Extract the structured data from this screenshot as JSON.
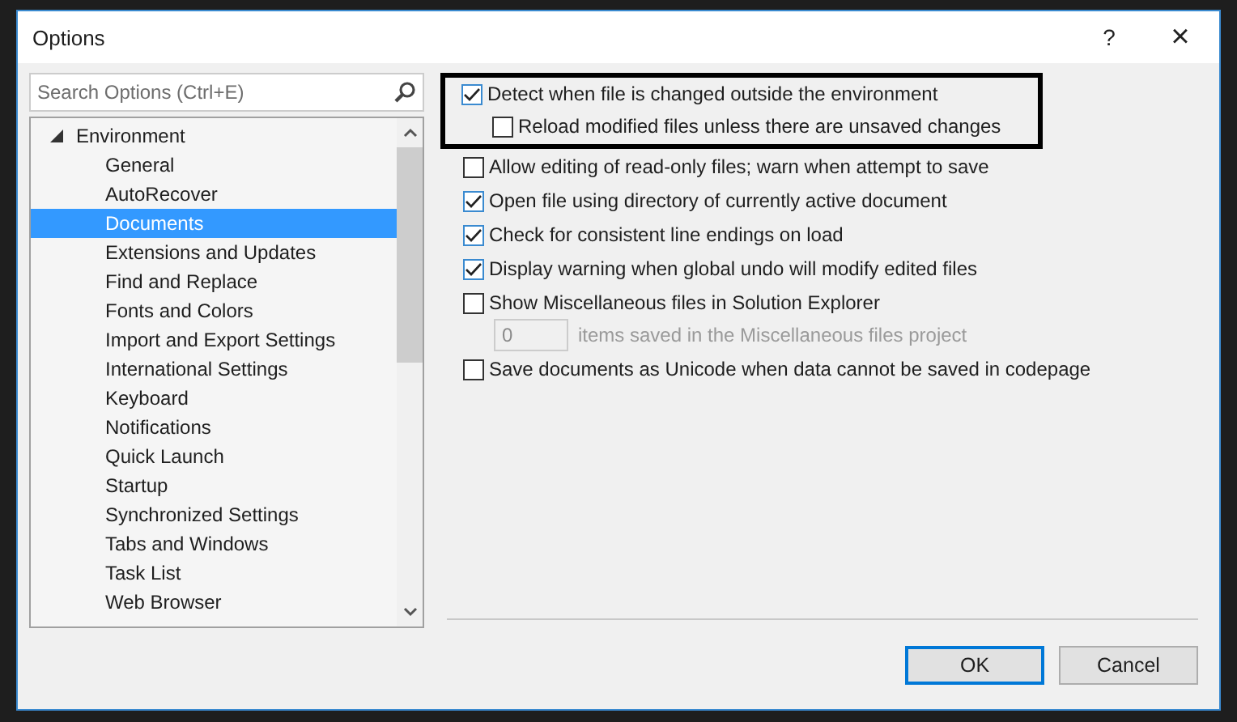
{
  "window": {
    "title": "Options",
    "help": "?",
    "close": "×"
  },
  "search": {
    "placeholder": "Search Options (Ctrl+E)"
  },
  "tree": [
    {
      "label": "Environment",
      "expanded": true,
      "selected": false,
      "children": [
        {
          "label": "General",
          "selected": false
        },
        {
          "label": "AutoRecover",
          "selected": false
        },
        {
          "label": "Documents",
          "selected": true
        },
        {
          "label": "Extensions and Updates",
          "selected": false
        },
        {
          "label": "Find and Replace",
          "selected": false
        },
        {
          "label": "Fonts and Colors",
          "selected": false
        },
        {
          "label": "Import and Export Settings",
          "selected": false
        },
        {
          "label": "International Settings",
          "selected": false
        },
        {
          "label": "Keyboard",
          "selected": false
        },
        {
          "label": "Notifications",
          "selected": false
        },
        {
          "label": "Quick Launch",
          "selected": false
        },
        {
          "label": "Startup",
          "selected": false
        },
        {
          "label": "Synchronized Settings",
          "selected": false
        },
        {
          "label": "Tabs and Windows",
          "selected": false
        },
        {
          "label": "Task List",
          "selected": false
        },
        {
          "label": "Web Browser",
          "selected": false
        }
      ]
    }
  ],
  "options": [
    {
      "kind": "checkbox",
      "label": "Detect when file is changed outside the environment",
      "checked": true,
      "highlighted": true,
      "children": [
        {
          "kind": "checkbox",
          "label": "Reload modified files unless there are unsaved changes",
          "checked": false
        }
      ]
    },
    {
      "kind": "checkbox",
      "label": "Allow editing of read-only files; warn when attempt to save",
      "checked": false,
      "highlighted": false
    },
    {
      "kind": "checkbox",
      "label": "Open file using directory of currently active document",
      "checked": true,
      "highlighted": false
    },
    {
      "kind": "checkbox",
      "label": "Check for consistent line endings on load",
      "checked": true,
      "highlighted": false
    },
    {
      "kind": "checkbox",
      "label": "Display warning when global undo will modify edited files",
      "checked": true,
      "highlighted": false
    },
    {
      "kind": "checkbox",
      "label": "Show Miscellaneous files in Solution Explorer",
      "checked": false,
      "highlighted": false,
      "children": [
        {
          "kind": "number",
          "value": "0",
          "label": "items saved in the Miscellaneous files project",
          "disabled": true
        }
      ]
    },
    {
      "kind": "checkbox",
      "label": "Save documents as Unicode when data cannot be saved in codepage",
      "checked": false,
      "highlighted": false
    }
  ],
  "buttons": [
    {
      "label": "OK",
      "default": true
    },
    {
      "label": "Cancel",
      "default": false
    }
  ]
}
